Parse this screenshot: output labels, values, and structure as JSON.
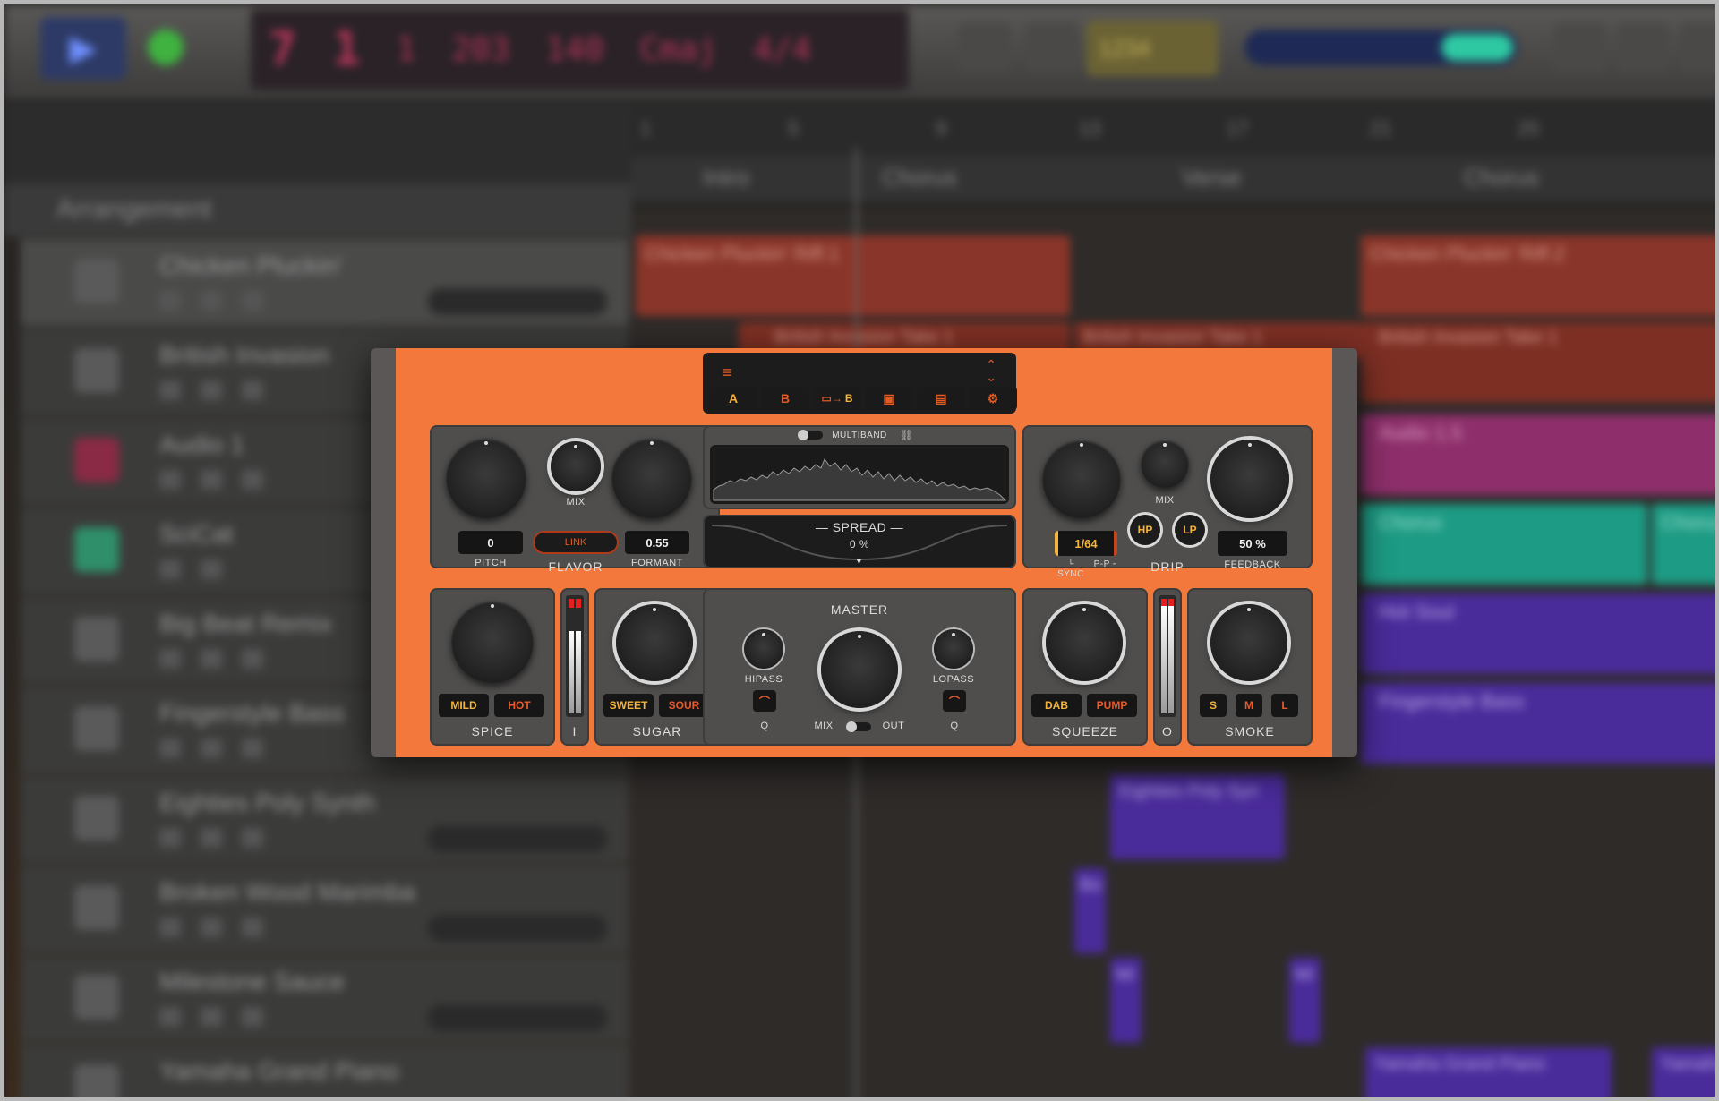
{
  "daw": {
    "lcd": [
      "7",
      "1",
      "1",
      "203",
      "140",
      "Cmaj",
      "4/4"
    ],
    "lcd2": "1234",
    "arrangement_label": "Arrangement",
    "ruler": [
      "1",
      "5",
      "9",
      "13",
      "17",
      "21",
      "25"
    ],
    "markers": [
      "Intro",
      "Chorus",
      "Verse",
      "Chorus"
    ],
    "tracks": [
      "Chicken Pluckin'",
      "British Invasion",
      "Audio 1",
      "SciCat",
      "Big Beat Remix",
      "Fingerstyle Bass",
      "Eighties Poly Synth",
      "Broken Wood Marimba",
      "Milestone Sauce",
      "Yamaha Grand Piano"
    ],
    "regions": [
      "Chicken Pluckin' Riff.1",
      "Chicken Pluckin' Riff.2",
      "British Invasion Take 1",
      "British Invasion Take 1",
      "British Invasion Take 1",
      "Audio 1.5",
      "Chorus",
      "Chorus",
      "Hot Soul",
      "Fingerstyle Bass",
      "Eighties Poly Syn",
      "Bo",
      "Mi",
      "Mi",
      "Yamaha Grand Piano",
      "Yamaha"
    ]
  },
  "plugin": {
    "header": {
      "menu_icon": "hamburger-icon",
      "tabs": [
        "A",
        "B",
        "A→B",
        "save",
        "copy",
        "settings"
      ]
    },
    "flavor": {
      "title": "FLAVOR",
      "pitch_label": "PITCH",
      "pitch_value": "0",
      "mix_label": "MIX",
      "formant_label": "FORMANT",
      "formant_value": "0.55",
      "link_label": "LINK"
    },
    "multiband": {
      "label": "MULTIBAND",
      "spread_label": "SPREAD",
      "spread_value": "0 %"
    },
    "drip": {
      "title": "DRIP",
      "sync_value": "1/64",
      "sync_label": "SYNC",
      "pp_label": "P-P",
      "mix_label": "MIX",
      "hp_label": "HP",
      "lp_label": "LP",
      "feedback_label": "FEEDBACK",
      "feedback_value": "50 %"
    },
    "spice": {
      "title": "SPICE",
      "mild": "MILD",
      "hot": "HOT"
    },
    "meter_in": "I",
    "sugar": {
      "title": "SUGAR",
      "sweet": "SWEET",
      "sour": "SOUR"
    },
    "master": {
      "title": "MASTER",
      "hipass": "HIPASS",
      "lopass": "LOPASS",
      "q_left": "Q",
      "q_right": "Q",
      "mix": "MIX",
      "out": "OUT"
    },
    "squeeze": {
      "title": "SQUEEZE",
      "dab": "DAB",
      "pump": "PUMP"
    },
    "meter_out": "O",
    "smoke": {
      "title": "SMOKE",
      "s": "S",
      "m": "M",
      "l": "L"
    }
  }
}
